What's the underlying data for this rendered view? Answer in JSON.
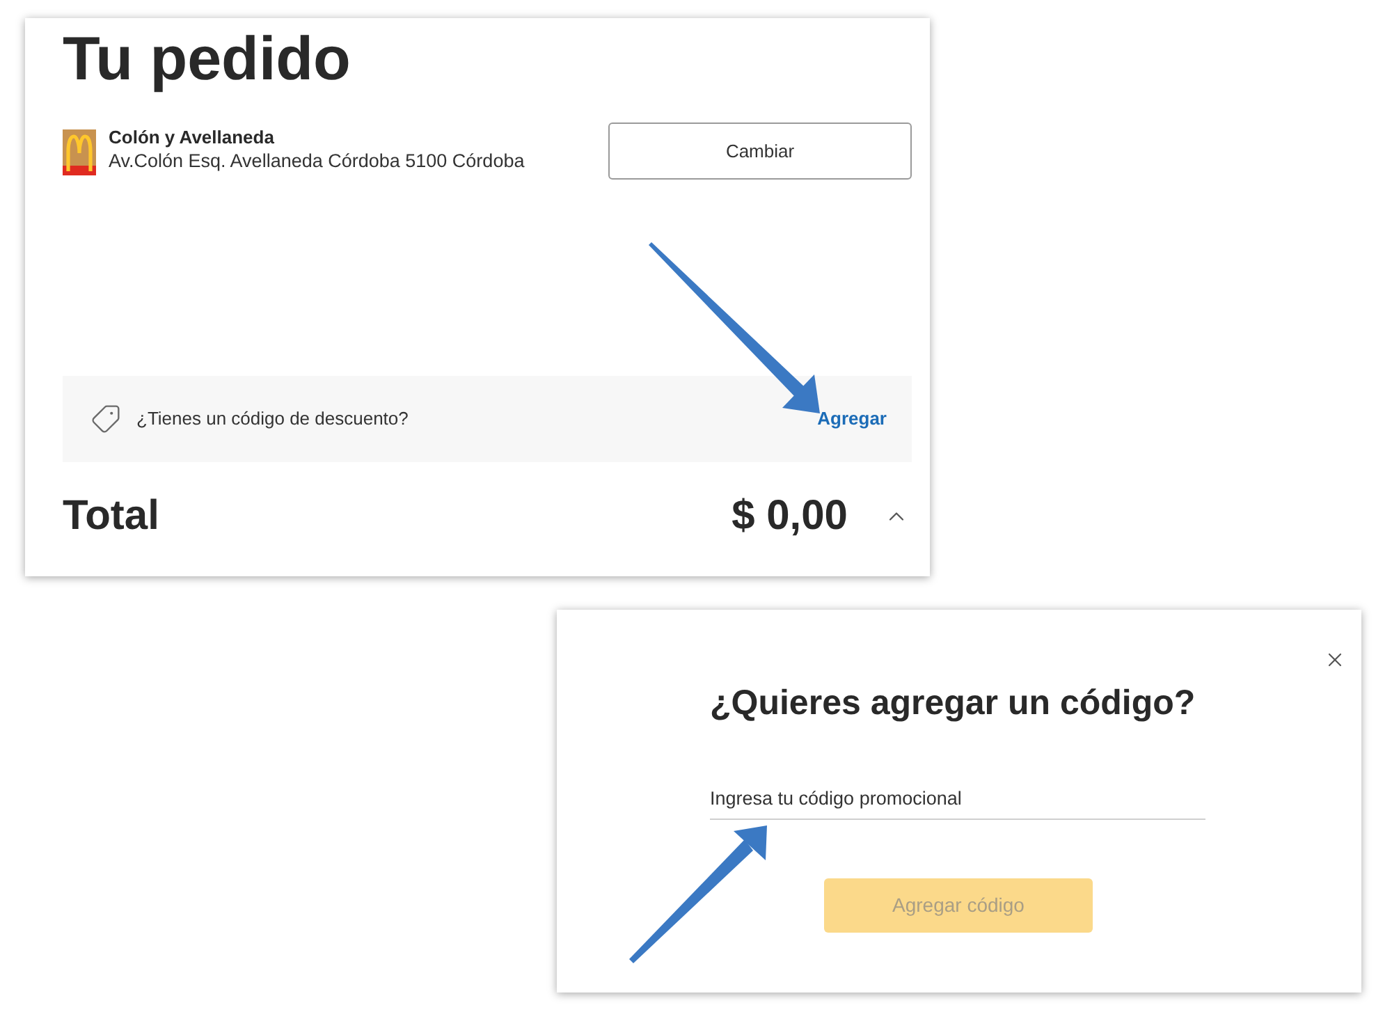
{
  "order_panel": {
    "title": "Tu pedido",
    "store": {
      "name": "Colón y Avellaneda",
      "address": "Av.Colón Esq. Avellaneda Córdoba 5100 Córdoba",
      "change_button": "Cambiar"
    },
    "discount": {
      "prompt": "¿Tienes un código de descuento?",
      "add_link": "Agregar"
    },
    "total": {
      "label": "Total",
      "amount": "$ 0,00"
    }
  },
  "code_dialog": {
    "title": "¿Quieres agregar un código?",
    "code_field": {
      "placeholder": "Ingresa tu código promocional"
    },
    "submit_button": {
      "label": "Agregar código",
      "disabled": true
    }
  }
}
